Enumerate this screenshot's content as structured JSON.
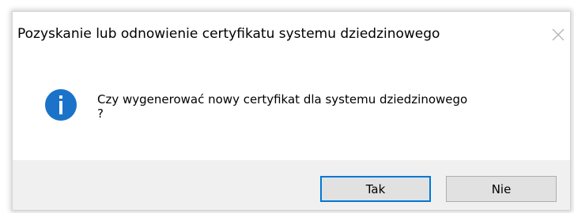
{
  "dialog": {
    "title": "Pozyskanie lub odnowienie certyfikatu systemu dziedzinowego",
    "message_line1": "Czy wygenerować nowy certyfikat dla systemu dziedzinowego",
    "message_line2": "?",
    "icon": "info-icon",
    "buttons": {
      "yes_label": "Tak",
      "no_label": "Nie"
    }
  },
  "colors": {
    "accent": "#0078d7",
    "icon_blue": "#1a73c9",
    "footer_bg": "#f0f0f0",
    "button_bg": "#e1e1e1"
  }
}
